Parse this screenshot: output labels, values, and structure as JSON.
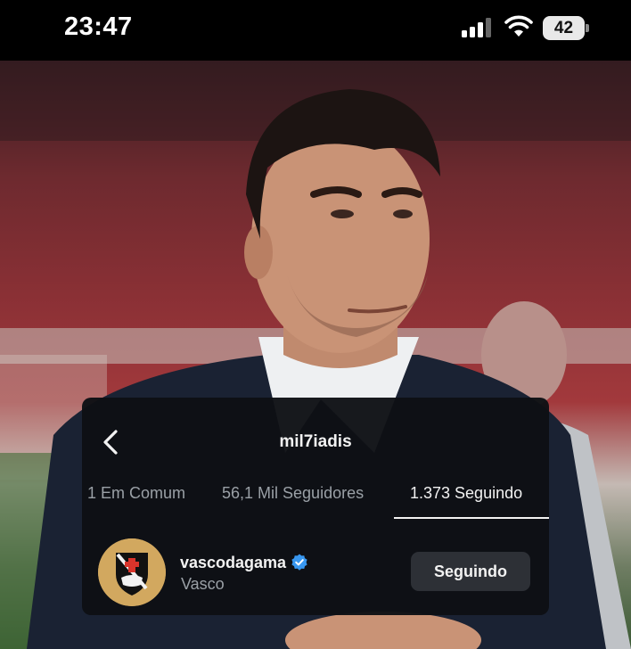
{
  "status_bar": {
    "time": "23:47",
    "battery_level": "42",
    "icons": [
      "cellular-signal-icon",
      "wifi-icon",
      "battery-icon"
    ]
  },
  "photo": {
    "icons": [
      "photo-background"
    ]
  },
  "overlay": {
    "username": "mil7iadis",
    "back_icon": "chevron-left-icon",
    "tabs": [
      {
        "label": "1 Em Comum",
        "active": false
      },
      {
        "label": "56,1 Mil Seguidores",
        "active": false
      },
      {
        "label": "1.373 Seguindo",
        "active": true
      }
    ],
    "following": [
      {
        "handle": "vascodagama",
        "verified": true,
        "name": "Vasco",
        "button_label": "Seguindo"
      }
    ]
  },
  "colors": {
    "card_background": "#0e1014",
    "button_background": "#2d3036",
    "verified_blue": "#3897f0",
    "text_primary": "#f2f2f2",
    "text_secondary": "#9aa0a6"
  }
}
